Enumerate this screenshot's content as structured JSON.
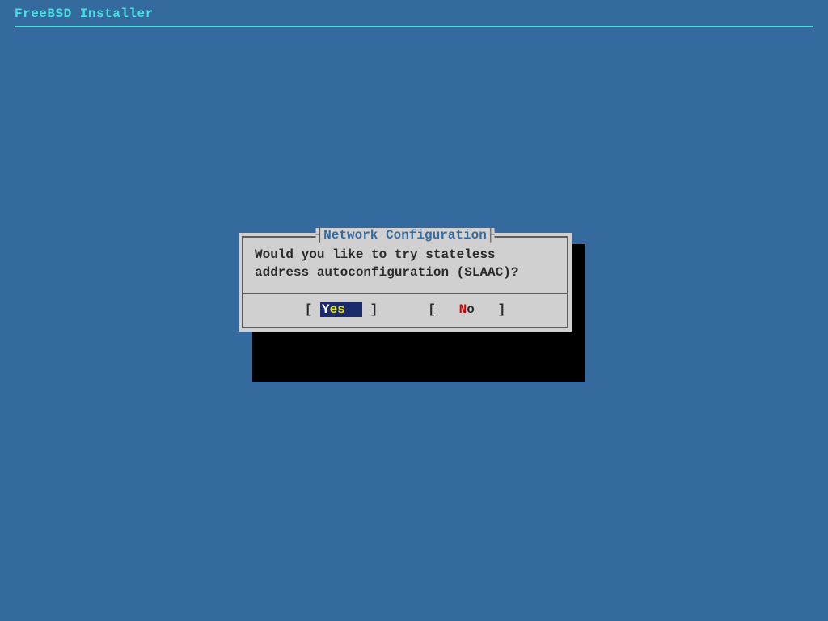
{
  "header": {
    "title": "FreeBSD Installer"
  },
  "dialog": {
    "title": "Network Configuration",
    "message": "Would you like to try stateless address autoconfiguration (SLAAC)?",
    "buttons": {
      "yes": {
        "hot": "Y",
        "rest": "es",
        "pad": "  "
      },
      "no": {
        "hot": "N",
        "rest": "o",
        "pad": "  "
      }
    }
  }
}
